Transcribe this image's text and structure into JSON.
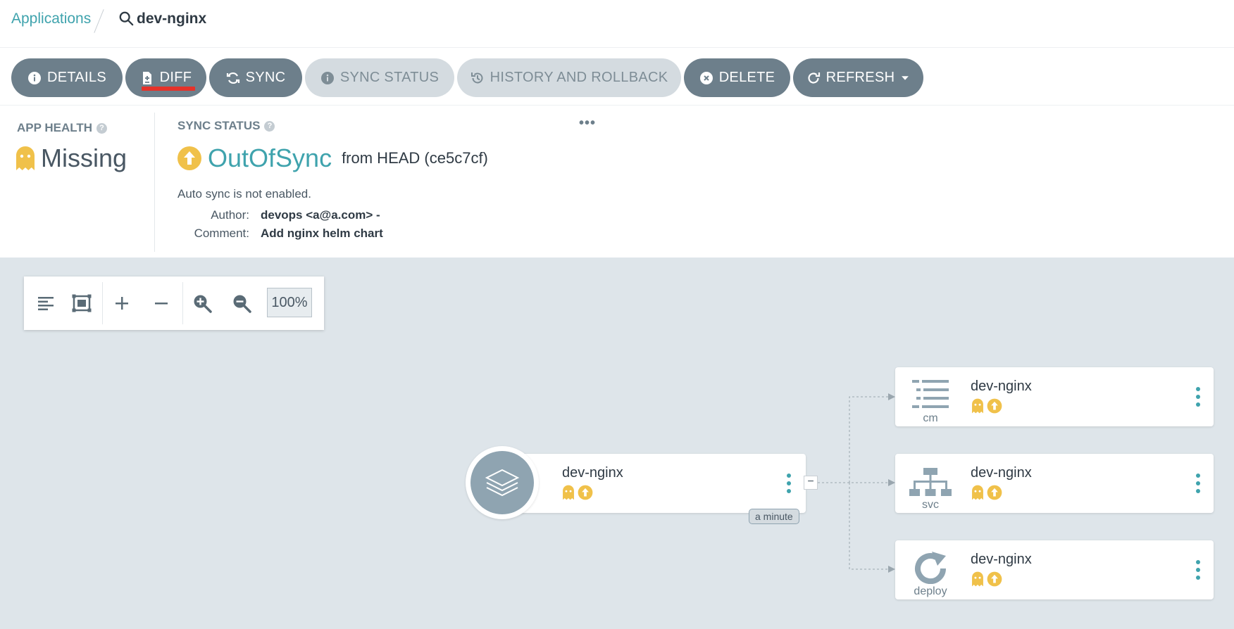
{
  "breadcrumb": {
    "applications_label": "Applications",
    "current_app": "dev-nginx"
  },
  "toolbar": {
    "buttons": [
      {
        "label": "DETAILS",
        "icon": "info-icon",
        "enabled": true
      },
      {
        "label": "DIFF",
        "icon": "file-diff-icon",
        "enabled": true
      },
      {
        "label": "SYNC",
        "icon": "sync-icon",
        "enabled": true
      },
      {
        "label": "SYNC STATUS",
        "icon": "info-icon",
        "enabled": false
      },
      {
        "label": "HISTORY AND ROLLBACK",
        "icon": "history-icon",
        "enabled": false
      },
      {
        "label": "DELETE",
        "icon": "close-circle-icon",
        "enabled": true
      },
      {
        "label": "REFRESH",
        "icon": "refresh-icon",
        "enabled": true
      }
    ]
  },
  "app_health": {
    "label": "APP HEALTH",
    "value": "Missing",
    "icon": "ghost-icon"
  },
  "sync_status": {
    "label": "SYNC STATUS",
    "value": "OutOfSync",
    "from": "from HEAD (ce5c7cf)",
    "auto_sync": "Auto sync is not enabled.",
    "author_label": "Author:",
    "author": "devops <a@a.com> -",
    "comment_label": "Comment:",
    "comment": "Add nginx helm chart",
    "more": "•••"
  },
  "graph_controls": {
    "zoom_level": "100%"
  },
  "graph": {
    "root": {
      "name": "dev-nginx",
      "time": "a minute",
      "collapse": "−"
    },
    "children": [
      {
        "name": "dev-nginx",
        "kind": "cm"
      },
      {
        "name": "dev-nginx",
        "kind": "svc"
      },
      {
        "name": "dev-nginx",
        "kind": "deploy"
      }
    ]
  },
  "colors": {
    "accent": "#3fa3ad",
    "button": "#6d7f8b",
    "missing": "#f0c14a",
    "out_of_sync": "#f0c14a",
    "graph_bg": "#dee5ea"
  }
}
